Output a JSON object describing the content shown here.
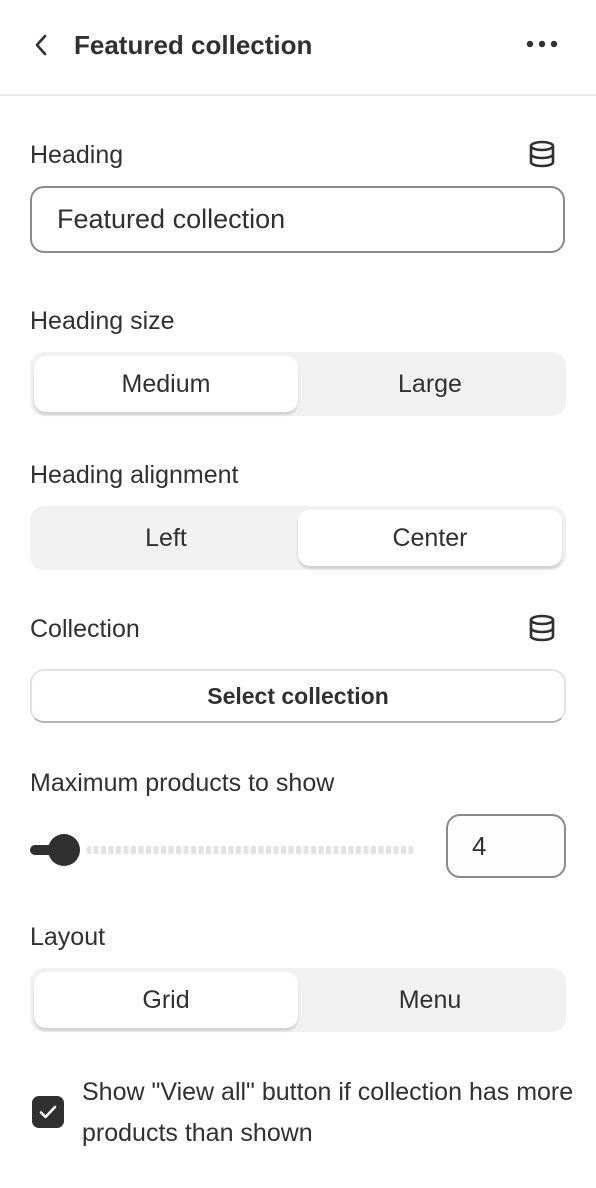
{
  "header": {
    "title": "Featured collection",
    "back_icon": "chevron-left-icon",
    "more_icon": "ellipsis-icon"
  },
  "heading": {
    "label": "Heading",
    "value": "Featured collection",
    "dynamic_source_icon": "database-icon"
  },
  "heading_size": {
    "label": "Heading size",
    "options": [
      "Medium",
      "Large"
    ],
    "selected": "Medium"
  },
  "heading_alignment": {
    "label": "Heading alignment",
    "options": [
      "Left",
      "Center"
    ],
    "selected": "Center"
  },
  "collection": {
    "label": "Collection",
    "button_label": "Select collection",
    "dynamic_source_icon": "database-icon"
  },
  "max_products": {
    "label": "Maximum products to show",
    "value": "4",
    "slider_fraction": 0.0
  },
  "layout": {
    "label": "Layout",
    "options": [
      "Grid",
      "Menu"
    ],
    "selected": "Grid"
  },
  "view_all": {
    "checked": true,
    "label": "Show \"View all\" button if collection has more products than shown"
  }
}
